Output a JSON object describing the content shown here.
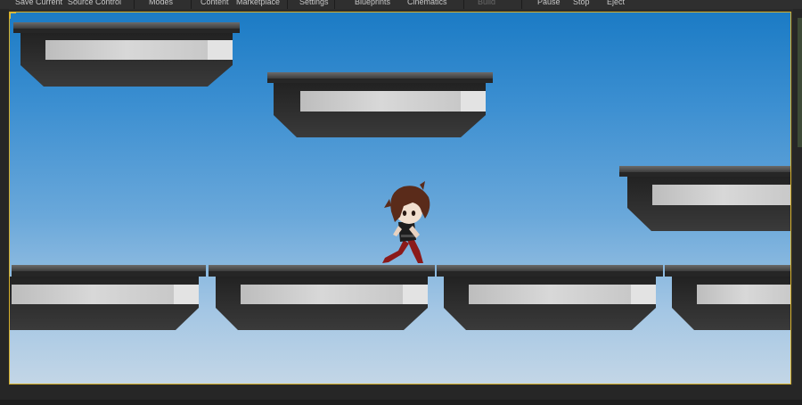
{
  "toolbar": {
    "save_current": "Save Current",
    "source_control": "Source Control",
    "modes": "Modes",
    "content": "Content",
    "marketplace": "Marketplace",
    "settings": "Settings",
    "blueprints": "Blueprints",
    "cinematics": "Cinematics",
    "build": "Build",
    "pause": "Pause",
    "stop": "Stop",
    "eject": "Eject"
  },
  "scene": {
    "sky_top_color": "#1b7bc5",
    "sky_bottom_color": "#c3d6e6",
    "viewport_border_color": "#d6b02a",
    "platform_dark_color": "#2e2e2e",
    "platform_light_color": "#d4d4d4",
    "character": {
      "hair_color": "#5a2b1a",
      "shirt_color": "#1d1d1d",
      "pants_color": "#8b1a1a",
      "state": "running"
    }
  }
}
